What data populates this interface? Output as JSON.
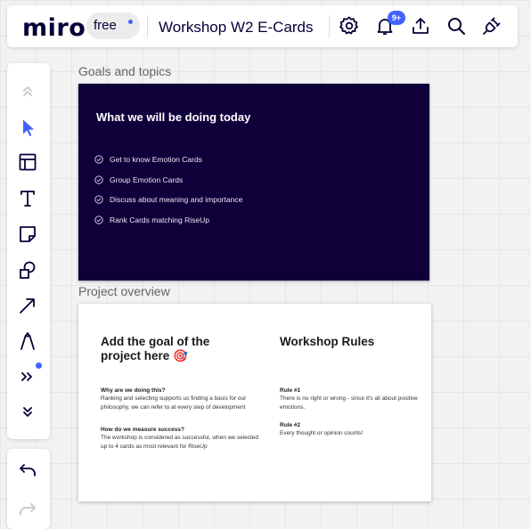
{
  "app": {
    "logo_text": "miro",
    "plan_label": "free",
    "board_name": "Workshop W2 E-Cards",
    "notification_count": "9+",
    "accent_color": "#4262ff"
  },
  "topbar_icons": [
    "gear-icon",
    "bell-icon",
    "upload-icon",
    "search-icon",
    "plug-icon"
  ],
  "toolbar": {
    "tools": [
      "collapse-up-icon",
      "select-cursor-icon",
      "templates-icon",
      "text-icon",
      "sticky-note-icon",
      "shapes-icon",
      "arrow-connector-icon",
      "pen-icon",
      "more-tools-icon",
      "expand-down-icon"
    ],
    "history": [
      "undo-icon",
      "redo-icon"
    ]
  },
  "frames": {
    "goals": {
      "title": "Goals and topics",
      "heading": "What we will be doing today",
      "items": [
        "Get to know Emotion Cards",
        "Group Emotion Cards",
        "Discuss about meaning and importance",
        "Rank Cards matching RiseUp"
      ],
      "background_color": "#0f003a"
    },
    "overview": {
      "title": "Project overview",
      "goal_heading": "Add the goal of the project here 🎯",
      "why_title": "Why are we doing this?",
      "why_body": "Ranking and selecting supports us finding a basis for our philosophy, we can refer to at every step of development",
      "success_title": "How do we measure success?",
      "success_body": "The workshop is considered as successful, when we selected up to 4 cards as most relevant for RiseUp",
      "rules_heading": "Workshop Rules",
      "rule1_title": "Rule #1",
      "rule1_body": "There is no right or wrong - since it's all about positive emotions.",
      "rule2_title": "Rule #2",
      "rule2_body": "Every thought or opinion counts!"
    }
  }
}
